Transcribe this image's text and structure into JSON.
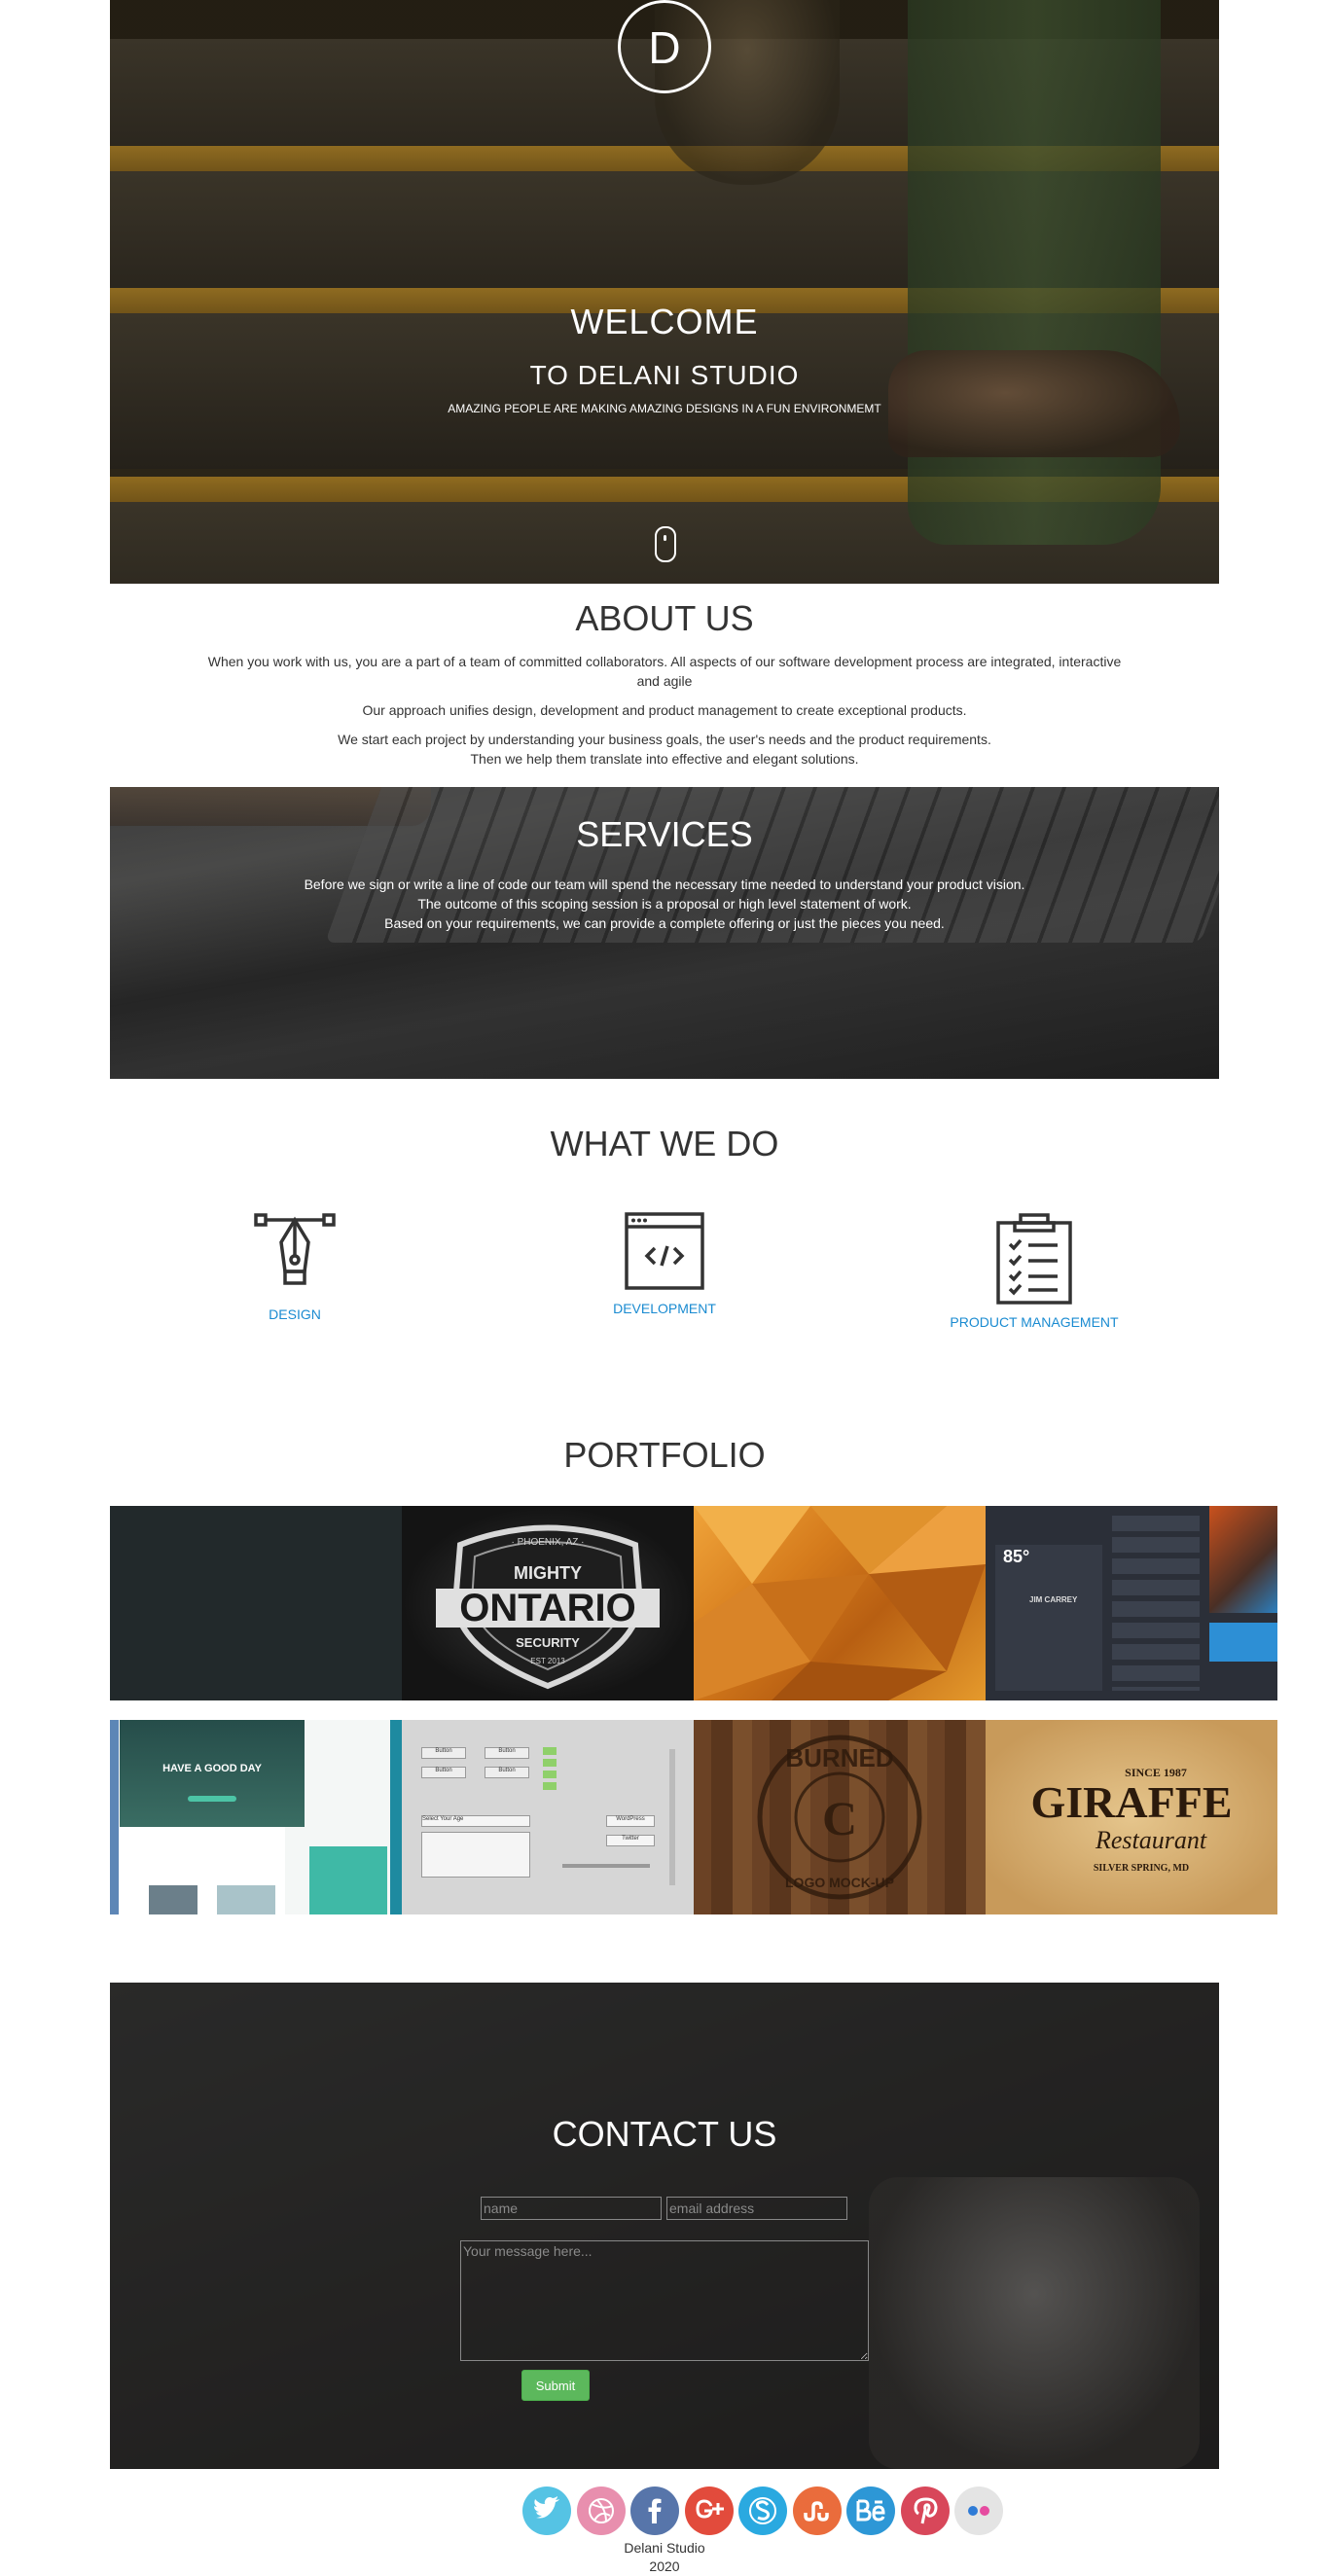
{
  "hero": {
    "logo_letter": "D",
    "welcome": "WELCOME",
    "subtitle": "TO DELANI STUDIO",
    "tagline": "AMAZING PEOPLE ARE MAKING AMAZING DESIGNS IN A FUN ENVIRONMEMT"
  },
  "about": {
    "title": "ABOUT US",
    "p1": "When you work with us, you are a part of a team of committed collaborators. All aspects of our software development process are integrated, interactive and agile",
    "p2": "Our approach unifies design, development and product management to create exceptional products.",
    "p3_line1": "We start each project by understanding your business goals, the user's needs and the product requirements.",
    "p3_line2": "Then we help them translate into effective and elegant solutions."
  },
  "services": {
    "title": "SERVICES",
    "line1": "Before we sign or write a line of code our team will spend the necessary time needed to understand your product vision.",
    "line2": "The outcome of this scoping session is a proposal or high level statement of work.",
    "line3": "Based on your requirements, we can provide a complete offering or just the pieces you need."
  },
  "what_we_do": {
    "title": "WHAT WE DO",
    "items": [
      {
        "label": "DESIGN",
        "icon": "pen-tool-icon"
      },
      {
        "label": "DEVELOPMENT",
        "icon": "code-window-icon"
      },
      {
        "label": "PRODUCT MANAGEMENT",
        "icon": "clipboard-checklist-icon"
      }
    ]
  },
  "portfolio": {
    "title": "PORTFOLIO",
    "tiles": [
      {
        "caption": ""
      },
      {
        "caption": "MIGHTY ONTARIO SECURITY",
        "top": "· PHOENIX, AZ ·",
        "main": "ONTARIO",
        "upper": "MIGHTY",
        "lower": "SECURITY",
        "est": "EST 2013"
      },
      {
        "caption": ""
      },
      {
        "caption": "JIM CARREY",
        "temp": "85°"
      },
      {
        "caption": "HAVE A GOOD DAY"
      },
      {
        "caption": "Button",
        "select": "Select Your Age",
        "wordpress": "WordPress",
        "twitter": "Twitter"
      },
      {
        "caption": "BURNED LOGO MOCK-UP",
        "upper": "BURNED",
        "lower": "LOGO MOCK-UP",
        "mark": "C"
      },
      {
        "caption": "GIRAFFE Restaurant",
        "since": "SINCE 1987",
        "main": "GIRAFFE",
        "script": "Restaurant",
        "place": "SILVER SPRING, MD"
      }
    ]
  },
  "contact": {
    "title": "CONTACT US",
    "name_placeholder": "name",
    "email_placeholder": "email address",
    "message_placeholder": "Your message here...",
    "submit_label": "Submit"
  },
  "footer": {
    "studio": "Delani Studio",
    "year": "2020",
    "social": [
      {
        "icon": "twitter-icon",
        "color": "#55c3e4"
      },
      {
        "icon": "dribbble-icon",
        "color": "#e88fae"
      },
      {
        "icon": "facebook-icon",
        "color": "#5775aa"
      },
      {
        "icon": "google-plus-icon",
        "color": "#e24b3c"
      },
      {
        "icon": "skype-icon",
        "color": "#2aa9e0"
      },
      {
        "icon": "stumbleupon-icon",
        "color": "#ea6c3c"
      },
      {
        "icon": "behance-icon",
        "color": "#2d97d6"
      },
      {
        "icon": "pinterest-icon",
        "color": "#d8475a"
      },
      {
        "icon": "flickr-icon",
        "color": "#e4e4e4"
      }
    ]
  },
  "colors": {
    "accent_link": "#1a8bd1",
    "submit_green": "#5cb85c"
  }
}
